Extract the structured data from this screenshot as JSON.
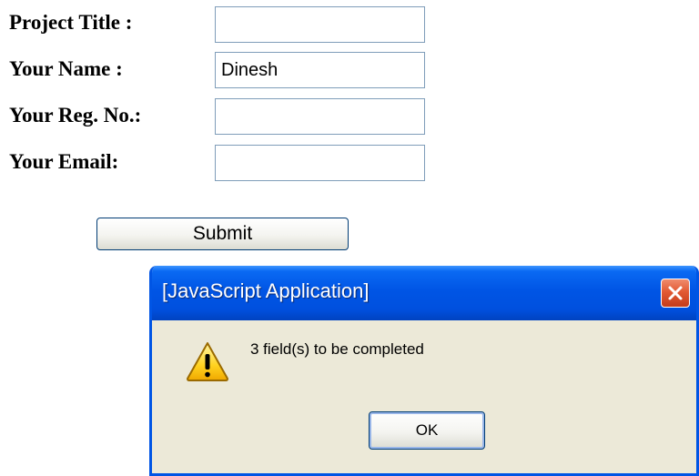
{
  "form": {
    "fields": [
      {
        "label": "Project Title :",
        "value": ""
      },
      {
        "label": "Your Name :",
        "value": "Dinesh"
      },
      {
        "label": "Your Reg. No.:",
        "value": ""
      },
      {
        "label": "Your Email:",
        "value": ""
      }
    ],
    "submit_label": "Submit"
  },
  "dialog": {
    "title": "[JavaScript Application]",
    "message": "3 field(s) to be completed",
    "ok_label": "OK",
    "icons": {
      "close": "close-icon",
      "warning": "warning-icon"
    }
  },
  "colors": {
    "titlebar": "#0055e5",
    "dialog_bg": "#ece9d8",
    "close_button": "#e25a34",
    "input_border": "#7f9db9",
    "warning_fill": "#ffd21f"
  }
}
